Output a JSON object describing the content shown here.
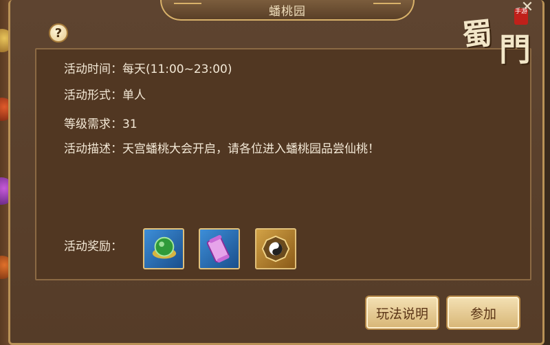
{
  "dialog": {
    "title": "蟠桃园",
    "help_glyph": "?",
    "close_glyph": "✕"
  },
  "logo": {
    "char1": "蜀",
    "char2": "門",
    "seal": "手游"
  },
  "info": {
    "time_label": "活动时间：",
    "time_value": "每天(11:00~23:00)",
    "form_label": "活动形式：",
    "form_value": "单人",
    "level_label": "等级需求：",
    "level_value": "31",
    "desc_label": "活动描述：",
    "desc_value": "天宫蟠桃大会开启，请各位进入蟠桃园品尝仙桃！"
  },
  "rewards": {
    "label": "活动奖励：",
    "items": [
      {
        "icon": "green-jade-ingot-icon",
        "color": "#2f9a3a"
      },
      {
        "icon": "purple-scroll-icon",
        "color": "#c86ad6"
      },
      {
        "icon": "taiji-bagua-icon",
        "color": "#d2a246"
      }
    ]
  },
  "buttons": {
    "rules_label": "玩法说明",
    "join_label": "参加"
  },
  "colors": {
    "panel_bg": "#513722",
    "border_gold": "#b99256",
    "text": "#f3e8d6",
    "button_text": "#5a3416"
  }
}
